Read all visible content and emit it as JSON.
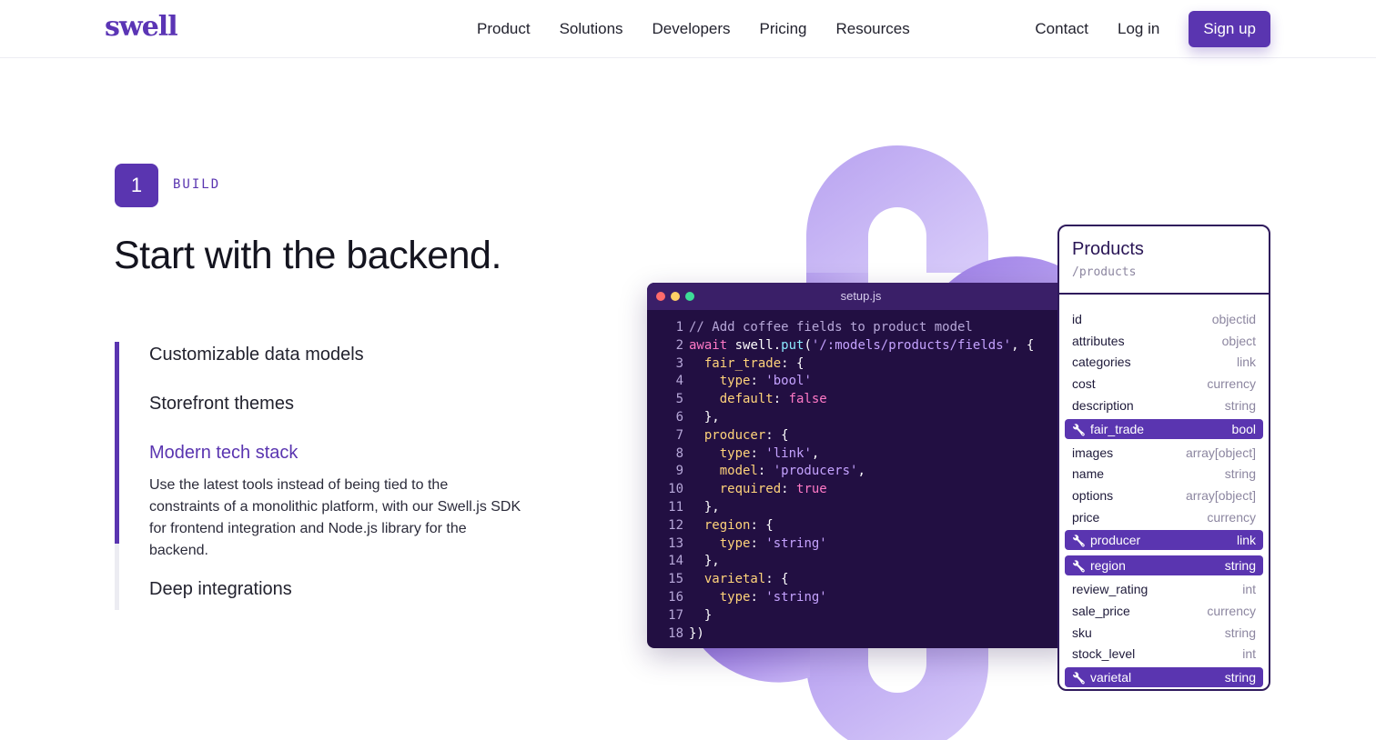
{
  "header": {
    "logo": "swell",
    "nav": [
      "Product",
      "Solutions",
      "Developers",
      "Pricing",
      "Resources"
    ],
    "contact": "Contact",
    "login": "Log in",
    "signup": "Sign up"
  },
  "step": {
    "number": "1",
    "label": "BUILD"
  },
  "headline": "Start with the backend.",
  "features": [
    {
      "label": "Customizable data models"
    },
    {
      "label": "Storefront themes"
    },
    {
      "label": "Modern tech stack",
      "description": "Use the latest tools instead of being tied to the constraints of a monolithic platform, with our Swell.js SDK for frontend integration and Node.js library for the backend."
    },
    {
      "label": "Deep integrations"
    }
  ],
  "code": {
    "filename": "setup.js",
    "lines": [
      [
        {
          "t": "// Add coffee fields to product model",
          "c": "com"
        }
      ],
      [
        {
          "t": "await",
          "c": "kw"
        },
        {
          "t": " swell",
          "c": "id"
        },
        {
          "t": ".",
          "c": "pun"
        },
        {
          "t": "put",
          "c": "fn"
        },
        {
          "t": "(",
          "c": "pun"
        },
        {
          "t": "'/:models/products/fields'",
          "c": "str"
        },
        {
          "t": ", {",
          "c": "pun"
        }
      ],
      [
        {
          "t": "  fair_trade",
          "c": "key"
        },
        {
          "t": ": {",
          "c": "pun"
        }
      ],
      [
        {
          "t": "    type",
          "c": "key"
        },
        {
          "t": ": ",
          "c": "pun"
        },
        {
          "t": "'bool'",
          "c": "str"
        }
      ],
      [
        {
          "t": "    default",
          "c": "key"
        },
        {
          "t": ": ",
          "c": "pun"
        },
        {
          "t": "false",
          "c": "bool"
        }
      ],
      [
        {
          "t": "  },",
          "c": "pun"
        }
      ],
      [
        {
          "t": "  producer",
          "c": "key"
        },
        {
          "t": ": {",
          "c": "pun"
        }
      ],
      [
        {
          "t": "    type",
          "c": "key"
        },
        {
          "t": ": ",
          "c": "pun"
        },
        {
          "t": "'link'",
          "c": "str"
        },
        {
          "t": ",",
          "c": "pun"
        }
      ],
      [
        {
          "t": "    model",
          "c": "key"
        },
        {
          "t": ": ",
          "c": "pun"
        },
        {
          "t": "'producers'",
          "c": "str"
        },
        {
          "t": ",",
          "c": "pun"
        }
      ],
      [
        {
          "t": "    required",
          "c": "key"
        },
        {
          "t": ": ",
          "c": "pun"
        },
        {
          "t": "true",
          "c": "bool"
        }
      ],
      [
        {
          "t": "  },",
          "c": "pun"
        }
      ],
      [
        {
          "t": "  region",
          "c": "key"
        },
        {
          "t": ": {",
          "c": "pun"
        }
      ],
      [
        {
          "t": "    type",
          "c": "key"
        },
        {
          "t": ": ",
          "c": "pun"
        },
        {
          "t": "'string'",
          "c": "str"
        }
      ],
      [
        {
          "t": "  },",
          "c": "pun"
        }
      ],
      [
        {
          "t": "  varietal",
          "c": "key"
        },
        {
          "t": ": {",
          "c": "pun"
        }
      ],
      [
        {
          "t": "    type",
          "c": "key"
        },
        {
          "t": ": ",
          "c": "pun"
        },
        {
          "t": "'string'",
          "c": "str"
        }
      ],
      [
        {
          "t": "  }",
          "c": "pun"
        }
      ],
      [
        {
          "t": "})",
          "c": "pun"
        }
      ]
    ]
  },
  "products": {
    "title": "Products",
    "path": "/products",
    "fields": [
      {
        "name": "id",
        "type": "objectid",
        "highlight": false
      },
      {
        "name": "attributes",
        "type": "object",
        "highlight": false
      },
      {
        "name": "categories",
        "type": "link",
        "highlight": false
      },
      {
        "name": "cost",
        "type": "currency",
        "highlight": false
      },
      {
        "name": "description",
        "type": "string",
        "highlight": false
      },
      {
        "name": "fair_trade",
        "type": "bool",
        "highlight": true
      },
      {
        "name": "images",
        "type": "array[object]",
        "highlight": false
      },
      {
        "name": "name",
        "type": "string",
        "highlight": false
      },
      {
        "name": "options",
        "type": "array[object]",
        "highlight": false
      },
      {
        "name": "price",
        "type": "currency",
        "highlight": false
      },
      {
        "name": "producer",
        "type": "link",
        "highlight": true
      },
      {
        "name": "region",
        "type": "string",
        "highlight": true
      },
      {
        "name": "review_rating",
        "type": "int",
        "highlight": false
      },
      {
        "name": "sale_price",
        "type": "currency",
        "highlight": false
      },
      {
        "name": "sku",
        "type": "string",
        "highlight": false
      },
      {
        "name": "stock_level",
        "type": "int",
        "highlight": false
      },
      {
        "name": "varietal",
        "type": "string",
        "highlight": true
      }
    ]
  },
  "colors": {
    "brand": "#5a35b0",
    "code_bg": "#220f42",
    "dot_red": "#ff6b6b",
    "dot_yellow": "#ffd166",
    "dot_green": "#3ddc97"
  }
}
